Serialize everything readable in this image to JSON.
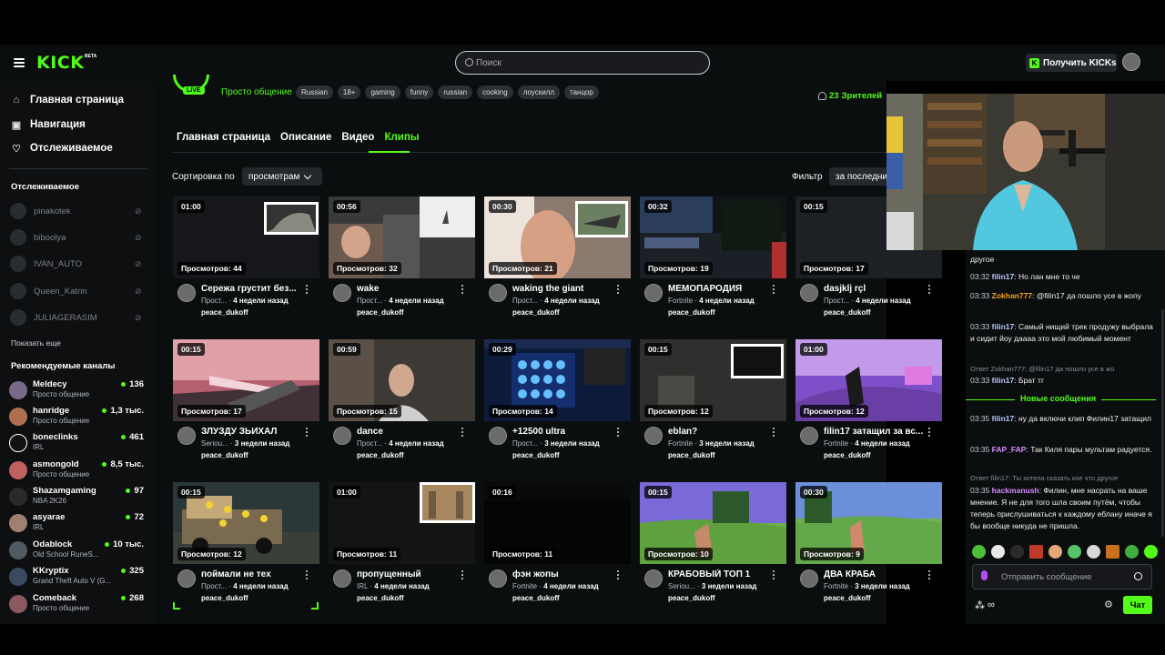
{
  "topbar": {
    "logo": "KICK",
    "logo_badge": "BETA",
    "search_placeholder": "Поиск",
    "get_kicks": "Получить KICKs"
  },
  "sidebar": {
    "nav": [
      {
        "label": "Главная страница",
        "icon": "home-icon"
      },
      {
        "label": "Навигация",
        "icon": "compass-icon"
      },
      {
        "label": "Отслеживаемое",
        "icon": "heart-icon"
      }
    ],
    "following_title": "Отслеживаемое",
    "following": [
      {
        "name": "pinakotek"
      },
      {
        "name": "biboolya"
      },
      {
        "name": "IVAN_AUTO"
      },
      {
        "name": "Queen_Katrin"
      },
      {
        "name": "JULIAGERASIM"
      }
    ],
    "show_more": "Показать еще",
    "recommended_title": "Рекомендуемые каналы",
    "recommended": [
      {
        "name": "Meldecy",
        "category": "Просто общение",
        "viewers": "136",
        "color": "#7a6a8a"
      },
      {
        "name": "hanridge",
        "category": "Просто общение",
        "viewers": "1,3 тыс.",
        "color": "#b07050"
      },
      {
        "name": "boneclinks",
        "category": "IRL",
        "viewers": "461",
        "color": "#ffffff"
      },
      {
        "name": "asmongold",
        "category": "Просто общение",
        "viewers": "8,5 тыс.",
        "color": "#c06060"
      },
      {
        "name": "Shazamgaming",
        "category": "NBA 2K26",
        "viewers": "97",
        "color": "#2a2a2a"
      },
      {
        "name": "asyarae",
        "category": "IRL",
        "viewers": "72",
        "color": "#a08070"
      },
      {
        "name": "Odablock",
        "category": "Old School RuneS...",
        "viewers": "10 тыс.",
        "color": "#505a60"
      },
      {
        "name": "KKryptix",
        "category": "Grand Theft Auto V (G...",
        "viewers": "325",
        "color": "#3a4a60"
      },
      {
        "name": "Comeback",
        "category": "Просто общение",
        "viewers": "268",
        "color": "#8a5a60"
      }
    ]
  },
  "channel": {
    "live_badge": "LIVE",
    "category": "Просто общение",
    "tags": [
      "Russian",
      "18+",
      "gaming",
      "funny",
      "russian",
      "cooking",
      "лоускилл",
      "танцор"
    ],
    "viewers_count": "23",
    "viewers_label": "Зрителей"
  },
  "tabs": [
    "Главная страница",
    "Описание",
    "Видео",
    "Клипы"
  ],
  "controls": {
    "sort_label": "Сортировка по",
    "sort_value": "просмотрам",
    "filter_label": "Фильтр",
    "filter_value": "за последние"
  },
  "clips": [
    {
      "duration": "01:00",
      "views": "Просмотров: 44",
      "title": "Сережа грустит без...",
      "category": "Прост...",
      "age": "4 недели назад",
      "author": "peace_dukoff"
    },
    {
      "duration": "00:56",
      "views": "Просмотров: 32",
      "title": "wake",
      "category": "Прост...",
      "age": "4 недели назад",
      "author": "peace_dukoff"
    },
    {
      "duration": "00:30",
      "views": "Просмотров: 21",
      "title": "waking the giant",
      "category": "Прост...",
      "age": "4 недели назад",
      "author": "peace_dukoff"
    },
    {
      "duration": "00:32",
      "views": "Просмотров: 19",
      "title": "МЕМОПАРОДИЯ",
      "category": "Fortnite",
      "age": "4 недели назад",
      "author": "peace_dukoff"
    },
    {
      "duration": "00:15",
      "views": "Просмотров: 17",
      "title": "dasjklj rçl",
      "category": "Прост...",
      "age": "4 недели назад",
      "author": "peace_dukoff"
    },
    {
      "duration": "00:15",
      "views": "Просмотров: 17",
      "title": "ЗЛУЗДУ ЗЬИХАЛ",
      "category": "Seriou...",
      "age": "3 недели назад",
      "author": "peace_dukoff"
    },
    {
      "duration": "00:59",
      "views": "Просмотров: 15",
      "title": "dance",
      "category": "Прост...",
      "age": "4 недели назад",
      "author": "peace_dukoff"
    },
    {
      "duration": "00:29",
      "views": "Просмотров: 14",
      "title": "+12500 ultra",
      "category": "Прост...",
      "age": "3 недели назад",
      "author": "peace_dukoff"
    },
    {
      "duration": "00:15",
      "views": "Просмотров: 12",
      "title": "eblan?",
      "category": "Fortnite",
      "age": "3 недели назад",
      "author": "peace_dukoff"
    },
    {
      "duration": "01:00",
      "views": "Просмотров: 12",
      "title": "filin17 затащил за вс...",
      "category": "Fortnite",
      "age": "4 недели назад",
      "author": "peace_dukoff"
    },
    {
      "duration": "00:15",
      "views": "Просмотров: 12",
      "title": "поймали не тех",
      "category": "Прост...",
      "age": "4 недели назад",
      "author": "peace_dukoff"
    },
    {
      "duration": "01:00",
      "views": "Просмотров: 11",
      "title": "пропущенный",
      "category": "IRL",
      "age": "4 недели назад",
      "author": "peace_dukoff"
    },
    {
      "duration": "00:16",
      "views": "Просмотров: 11",
      "title": "фэн жопы",
      "category": "Fortnite",
      "age": "4 недели назад",
      "author": "peace_dukoff"
    },
    {
      "duration": "00:15",
      "views": "Просмотров: 10",
      "title": "КРАБОВЫЙ ТОП 1",
      "category": "Seriou...",
      "age": "3 недели назад",
      "author": "peace_dukoff"
    },
    {
      "duration": "00:30",
      "views": "Просмотров: 9",
      "title": "ДВА КРАБА",
      "category": "Fortnite",
      "age": "3 недели назад",
      "author": "peace_dukoff"
    }
  ],
  "chat": {
    "messages": [
      {
        "time": "",
        "user": "",
        "text": "другое",
        "color": "#ffffff"
      },
      {
        "time": "03:32",
        "user": "filin17",
        "text": "Но лан мне то че",
        "color": "#b9c8ff"
      },
      {
        "time": "03:33",
        "user": "Zokhan777",
        "text": "@filin17 да пошло усе в жопу",
        "color": "#f5a623"
      },
      {
        "time": "03:33",
        "user": "filin17",
        "text": "Самый нищий трек продужу выбрала и сидит йоу даааа это мой любимый момент",
        "color": "#b9c8ff"
      },
      {
        "time": "03:33",
        "user": "filin17",
        "text": "Брат тг",
        "color": "#b9c8ff"
      },
      {
        "time": "03:35",
        "user": "filin17",
        "text": "ну да включи клип Филин17 затащил",
        "color": "#b9c8ff"
      },
      {
        "time": "03:35",
        "user": "FAP_FAP",
        "text": "Так Киля пары мультам радуется.",
        "color": "#d58bff"
      },
      {
        "time": "03:35",
        "user": "hackmanush",
        "text": "Филин, мне насрать на ваше мнение. Я не для того шла своим путём, чтобы теперь прислушиваться к каждому еблану иначе я бы вообще никуда не пришла.",
        "color": "#d58bff"
      }
    ],
    "replies": [
      "Ответ Zokhan777: @filin17 да пошло усе в жо",
      "Ответ filin17: Ты хотела сказать кое что другое"
    ],
    "new_messages": "Новые сообщения",
    "input_placeholder": "Отправить сообщение",
    "infinity": "∞",
    "send_button": "Чат"
  }
}
